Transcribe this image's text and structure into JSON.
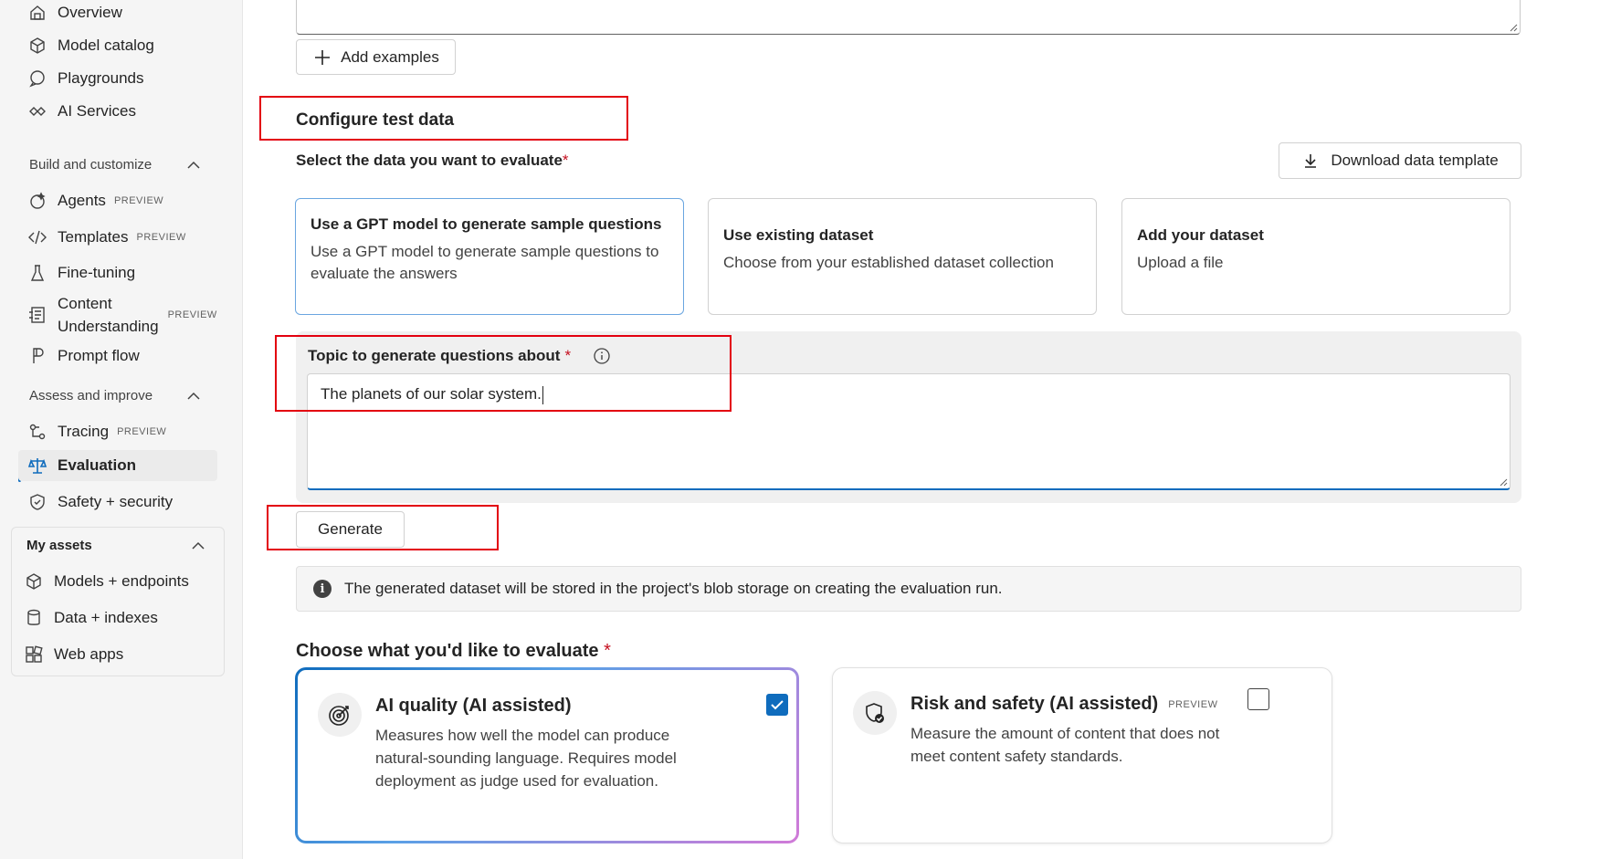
{
  "sidebar": {
    "top_items": [
      {
        "label": "Overview",
        "icon": "overview-icon"
      },
      {
        "label": "Model catalog",
        "icon": "cube-icon"
      },
      {
        "label": "Playgrounds",
        "icon": "chat-icon"
      },
      {
        "label": "AI Services",
        "icon": "link-icon"
      }
    ],
    "build_section": {
      "title": "Build and customize",
      "items": [
        {
          "label": "Agents",
          "badge": "PREVIEW",
          "icon": "agent-icon"
        },
        {
          "label": "Templates",
          "badge": "PREVIEW",
          "icon": "code-icon"
        },
        {
          "label": "Fine-tuning",
          "icon": "flask-icon"
        },
        {
          "label_line1": "Content",
          "label_line2": "Understanding",
          "badge": "PREVIEW",
          "icon": "document-icon"
        },
        {
          "label": "Prompt flow",
          "icon": "flow-icon"
        }
      ]
    },
    "assess_section": {
      "title": "Assess and improve",
      "items": [
        {
          "label": "Tracing",
          "badge": "PREVIEW",
          "icon": "tracing-icon"
        },
        {
          "label": "Evaluation",
          "icon": "scale-icon",
          "active": true
        },
        {
          "label": "Safety + security",
          "icon": "shield-icon"
        }
      ]
    },
    "assets_section": {
      "title": "My assets",
      "items": [
        {
          "label": "Models + endpoints",
          "icon": "cube-icon"
        },
        {
          "label": "Data + indexes",
          "icon": "database-icon"
        },
        {
          "label": "Web apps",
          "icon": "apps-icon"
        }
      ]
    }
  },
  "main": {
    "add_examples_label": "Add examples",
    "configure_title": "Configure test data",
    "select_label": "Select the data you want to evaluate",
    "required_mark": "*",
    "download_label": "Download data template",
    "cards": [
      {
        "title": "Use a GPT model to generate sample questions",
        "desc": "Use a GPT model to generate sample questions to evaluate the answers",
        "selected": true
      },
      {
        "title": "Use existing dataset",
        "desc": "Choose from your established dataset collection"
      },
      {
        "title": "Add your dataset",
        "desc": "Upload a file"
      }
    ],
    "topic_label": "Topic to generate questions about",
    "topic_value": "The planets of our solar system.",
    "generate_label": "Generate",
    "info_text": "The generated dataset will be stored in the project's blob storage on creating the evaluation run.",
    "evaluate_title": "Choose what you'd like to evaluate",
    "eval_options": [
      {
        "title": "AI quality (AI assisted)",
        "desc": "Measures how well the model can produce natural-sounding language. Requires model deployment as judge used for evaluation.",
        "checked": true,
        "icon": "target-icon"
      },
      {
        "title": "Risk and safety (AI assisted)",
        "badge": "PREVIEW",
        "desc": "Measure the amount of content that does not meet content safety standards.",
        "checked": false,
        "icon": "shield-check-icon"
      }
    ]
  },
  "colors": {
    "accent": "#0f6cbd",
    "highlight": "#e3000f",
    "required": "#c50f1f"
  }
}
